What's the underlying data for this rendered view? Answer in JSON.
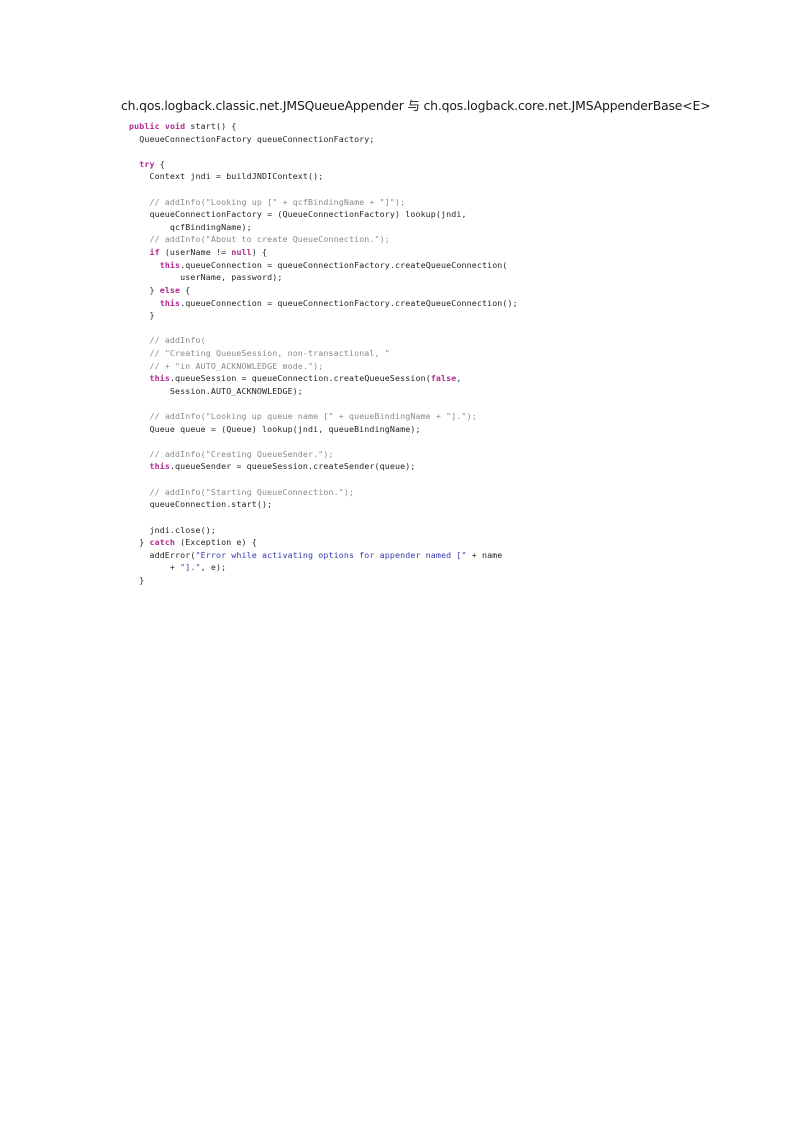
{
  "document": {
    "title": "ch.qos.logback.classic.net.JMSQueueAppender 与 ch.qos.logback.core.net.JMSAppenderBase<E>",
    "title_left_part": "ch.qos.logback.classic.net.JMSQueueAppender",
    "title_conjunction": "与",
    "title_right_part": "ch.qos.logback.core.net.JMSAppenderBase<E>",
    "page_background": "#ffffff",
    "text_color": "#1a1a1a"
  },
  "syntax_colors": {
    "keyword": "#b02a8f",
    "comment": "#8a8a8a",
    "string": "#3a38b0",
    "plain": "#231f20"
  },
  "code": {
    "language": "java",
    "lines": [
      {
        "id": 1,
        "text": "public void start() {"
      },
      {
        "id": 2,
        "text": "  QueueConnectionFactory queueConnectionFactory;"
      },
      {
        "id": 3,
        "text": ""
      },
      {
        "id": 4,
        "text": "  try {"
      },
      {
        "id": 5,
        "text": "    Context jndi = buildJNDIContext();"
      },
      {
        "id": 6,
        "text": ""
      },
      {
        "id": 7,
        "text": "    // addInfo(\"Looking up [\" + qcfBindingName + \"]\");"
      },
      {
        "id": 8,
        "text": "    queueConnectionFactory = (QueueConnectionFactory) lookup(jndi,"
      },
      {
        "id": 9,
        "text": "        qcfBindingName);"
      },
      {
        "id": 10,
        "text": "    // addInfo(\"About to create QueueConnection.\");"
      },
      {
        "id": 11,
        "text": "    if (userName != null) {"
      },
      {
        "id": 12,
        "text": "      this.queueConnection = queueConnectionFactory.createQueueConnection("
      },
      {
        "id": 13,
        "text": "          userName, password);"
      },
      {
        "id": 14,
        "text": "    } else {"
      },
      {
        "id": 15,
        "text": "      this.queueConnection = queueConnectionFactory.createQueueConnection();"
      },
      {
        "id": 16,
        "text": "    }"
      },
      {
        "id": 17,
        "text": ""
      },
      {
        "id": 18,
        "text": "    // addInfo("
      },
      {
        "id": 19,
        "text": "    // \"Creating QueueSession, non-transactional, \""
      },
      {
        "id": 20,
        "text": "    // + \"in AUTO_ACKNOWLEDGE mode.\");"
      },
      {
        "id": 21,
        "text": "    this.queueSession = queueConnection.createQueueSession(false,"
      },
      {
        "id": 22,
        "text": "        Session.AUTO_ACKNOWLEDGE);"
      },
      {
        "id": 23,
        "text": ""
      },
      {
        "id": 24,
        "text": "    // addInfo(\"Looking up queue name [\" + queueBindingName + \"].\");"
      },
      {
        "id": 25,
        "text": "    Queue queue = (Queue) lookup(jndi, queueBindingName);"
      },
      {
        "id": 26,
        "text": ""
      },
      {
        "id": 27,
        "text": "    // addInfo(\"Creating QueueSender.\");"
      },
      {
        "id": 28,
        "text": "    this.queueSender = queueSession.createSender(queue);"
      },
      {
        "id": 29,
        "text": ""
      },
      {
        "id": 30,
        "text": "    // addInfo(\"Starting QueueConnection.\");"
      },
      {
        "id": 31,
        "text": "    queueConnection.start();"
      },
      {
        "id": 32,
        "text": ""
      },
      {
        "id": 33,
        "text": "    jndi.close();"
      },
      {
        "id": 34,
        "text": "  } catch (Exception e) {"
      },
      {
        "id": 35,
        "text": "    addError(\"Error while activating options for appender named [\" + name"
      },
      {
        "id": 36,
        "text": "        + \"].\", e);"
      },
      {
        "id": 37,
        "text": "  }"
      }
    ]
  }
}
